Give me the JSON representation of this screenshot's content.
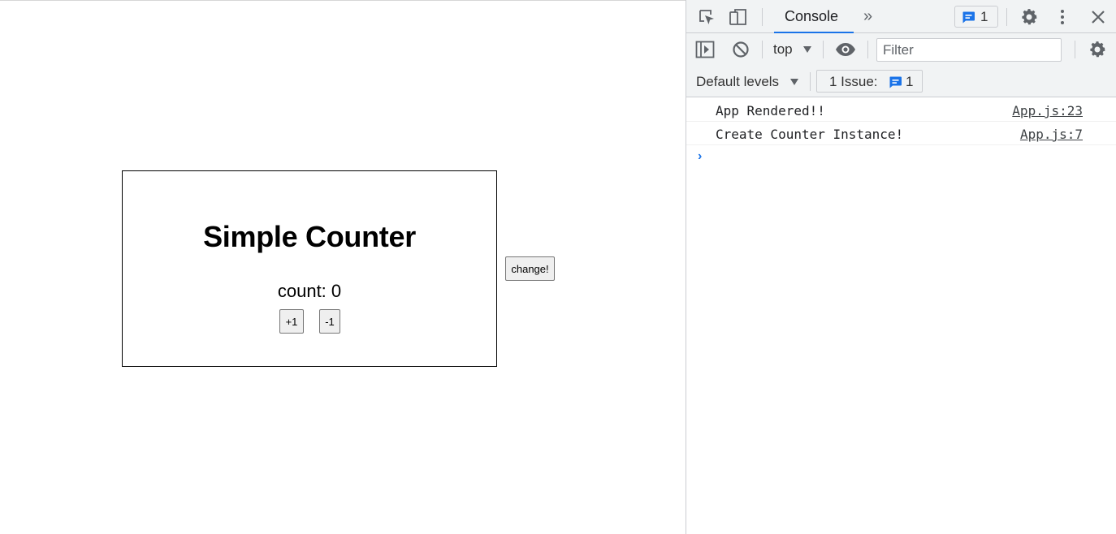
{
  "page": {
    "title": "Simple Counter",
    "count_text": "count: 0",
    "plus_label": "+1",
    "minus_label": "-1",
    "change_label": "change!"
  },
  "devtools": {
    "tabs": {
      "console_label": "Console",
      "more_tabs_glyph": "»",
      "issues_count": "1"
    },
    "toolbar": {
      "context": "top",
      "filter_placeholder": "Filter"
    },
    "levels": {
      "default_levels_label": "Default levels",
      "issue_label": "1 Issue:",
      "issue_count": "1"
    },
    "console": {
      "messages": [
        {
          "text": "App Rendered!!",
          "source": "App.js:23"
        },
        {
          "text": "Create Counter Instance!",
          "source": "App.js:7"
        }
      ],
      "prompt": "›"
    },
    "colors": {
      "accent": "#1a73e8",
      "icon": "#5f6368",
      "toolbar_bg": "#f1f3f4"
    }
  }
}
